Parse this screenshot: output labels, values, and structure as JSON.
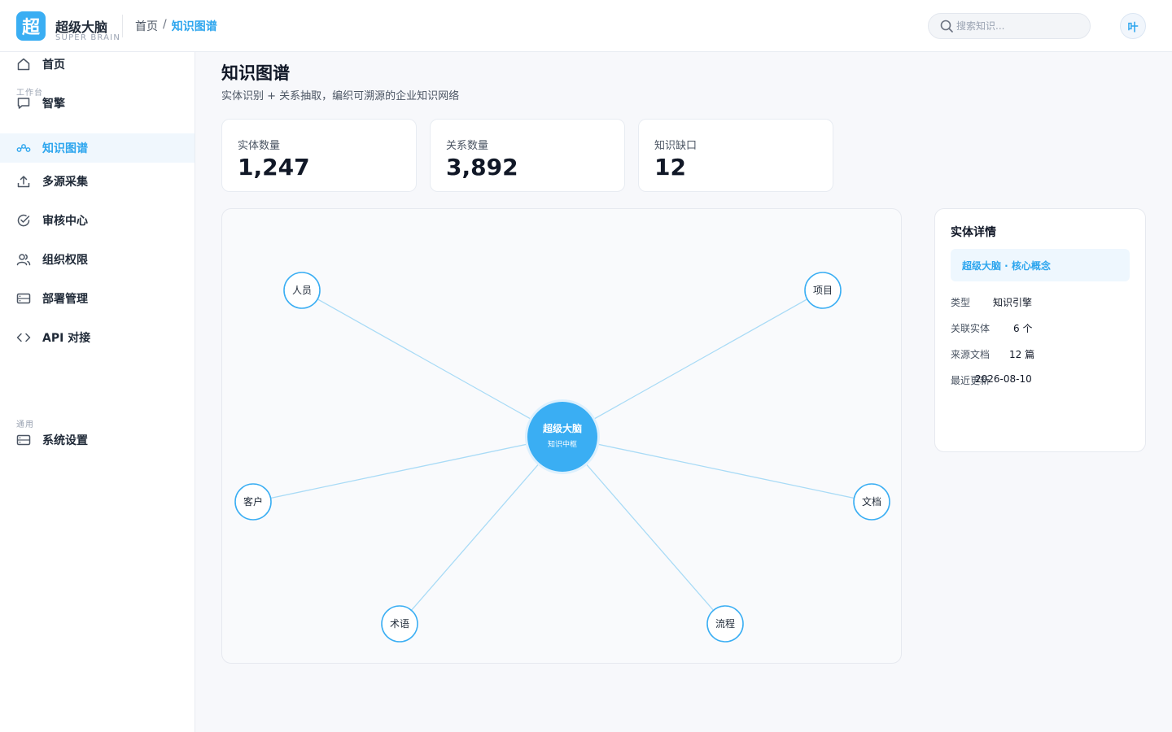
{
  "header": {
    "logo_char": "超",
    "brand_name": "超级大脑",
    "brand_sub": "SUPER BRAIN",
    "breadcrumb": [
      "首页",
      "/",
      "知识图谱"
    ],
    "search_placeholder": "搜索知识...",
    "avatar": "叶"
  },
  "sidebar": {
    "items": [
      {
        "label": "首页",
        "icon": "home-icon"
      },
      {
        "label": "智擎",
        "icon": "chat-icon"
      },
      {
        "label": "知识图谱",
        "icon": "graph-icon"
      },
      {
        "label": "多源采集",
        "icon": "upload-icon"
      },
      {
        "label": "审核中心",
        "icon": "check-circle-icon"
      },
      {
        "label": "组织权限",
        "icon": "users-icon"
      },
      {
        "label": "部署管理",
        "icon": "server-icon"
      },
      {
        "label": "API 对接",
        "icon": "code-icon"
      },
      {
        "label": "系统设置",
        "icon": "settings-panel-icon"
      }
    ],
    "section_workbench": "工作台",
    "section_general": "通用"
  },
  "main": {
    "title": "知识图谱",
    "subtitle": "实体识别 + 关系抽取，编织可溯源的企业知识网络",
    "stats": [
      {
        "label": "实体数量",
        "value": "1,247"
      },
      {
        "label": "关系数量",
        "value": "3,892"
      },
      {
        "label": "知识缺口",
        "value": "12"
      }
    ]
  },
  "graph": {
    "center": {
      "title": "超级大脑",
      "sub": "知识中枢"
    },
    "nodes": [
      "人员",
      "项目",
      "客户",
      "文档",
      "术语",
      "流程"
    ]
  },
  "detail": {
    "title": "实体详情",
    "highlight": "超级大脑 · 核心概念",
    "rows": [
      {
        "k": "类型",
        "v": "知识引擎"
      },
      {
        "k": "关联实体",
        "v": "6 个"
      },
      {
        "k": "来源文档",
        "v": "12 篇"
      },
      {
        "k": "最近更新",
        "v": "2026-08-10"
      }
    ]
  },
  "colors": {
    "accent": "#3aaef3",
    "accent_text": "#2ea6ee"
  }
}
